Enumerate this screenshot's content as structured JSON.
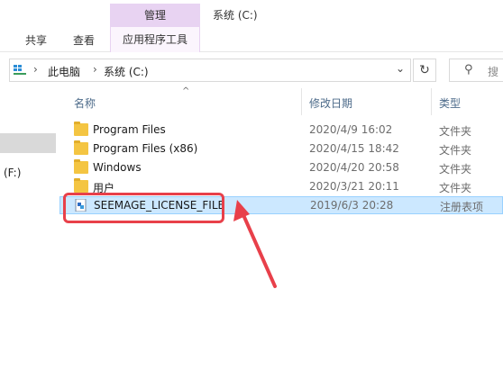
{
  "titlebar": {
    "context_tab_label": "管理",
    "window_title": "系统 (C:)"
  },
  "ribbon": {
    "tabs": [
      {
        "label": "共享"
      },
      {
        "label": "查看"
      }
    ],
    "context_tab_sub_label": "应用程序工具"
  },
  "address": {
    "crumbs": [
      "此电脑",
      "系统 (C:)"
    ],
    "search_placeholder": "搜"
  },
  "navpane": {
    "drive_label": "(F:)"
  },
  "columns": {
    "name": "名称",
    "date": "修改日期",
    "type": "类型"
  },
  "files": [
    {
      "name": "Program Files",
      "date": "2020/4/9 16:02",
      "type": "文件夹",
      "icon": "folder-icon"
    },
    {
      "name": "Program Files (x86)",
      "date": "2020/4/15 18:42",
      "type": "文件夹",
      "icon": "folder-icon"
    },
    {
      "name": "Windows",
      "date": "2020/4/20 20:58",
      "type": "文件夹",
      "icon": "folder-icon"
    },
    {
      "name": "用户",
      "date": "2020/3/21 20:11",
      "type": "文件夹",
      "icon": "folder-icon"
    },
    {
      "name": "SEEMAGE_LICENSE_FILE",
      "date": "2019/6/3 20:28",
      "type": "注册表项",
      "icon": "registry-file-icon",
      "selected": true
    }
  ],
  "colors": {
    "context_tab": "#e8d3f2",
    "selection": "#cce8ff",
    "annotation": "#e8404a",
    "folder": "#f4c542"
  }
}
